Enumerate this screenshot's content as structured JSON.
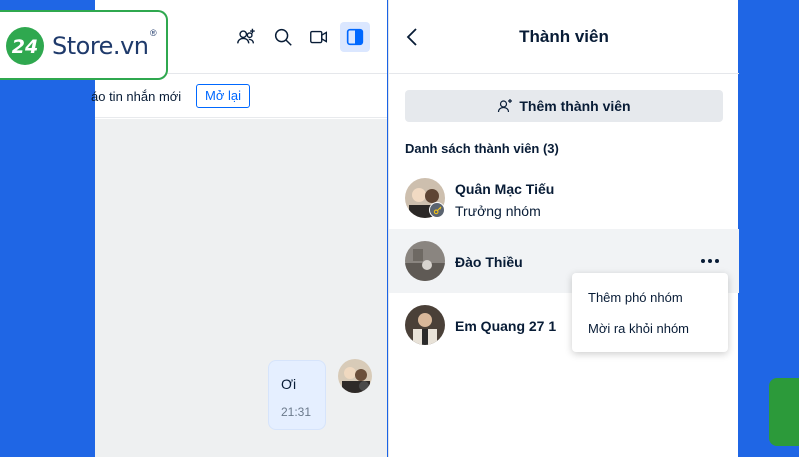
{
  "chat": {
    "notice_text": "áo tin nhắn mới",
    "reload_label": "Mở lại",
    "message": {
      "text": "Ơi",
      "time": "21:31"
    }
  },
  "header_icons": [
    "add-friend-icon",
    "search-icon",
    "video-call-icon",
    "panel-toggle-icon"
  ],
  "panel": {
    "title": "Thành viên",
    "add_button": "Thêm thành viên",
    "list_title": "Danh sách thành viên (3)",
    "members": [
      {
        "name": "Quân Mạc Tiếu",
        "role": "Trưởng nhóm"
      },
      {
        "name": "Đào Thiều",
        "role": ""
      },
      {
        "name": "Em Quang 27 1",
        "role": ""
      }
    ],
    "menu": [
      "Thêm phó nhóm",
      "Mời ra khỏi nhóm"
    ]
  },
  "logo": {
    "number": "24",
    "text": "Store.vn",
    "reg": "®"
  },
  "colors": {
    "accent": "#0068ff",
    "background": "#1f66e5",
    "logo_green": "#2fa84f"
  }
}
